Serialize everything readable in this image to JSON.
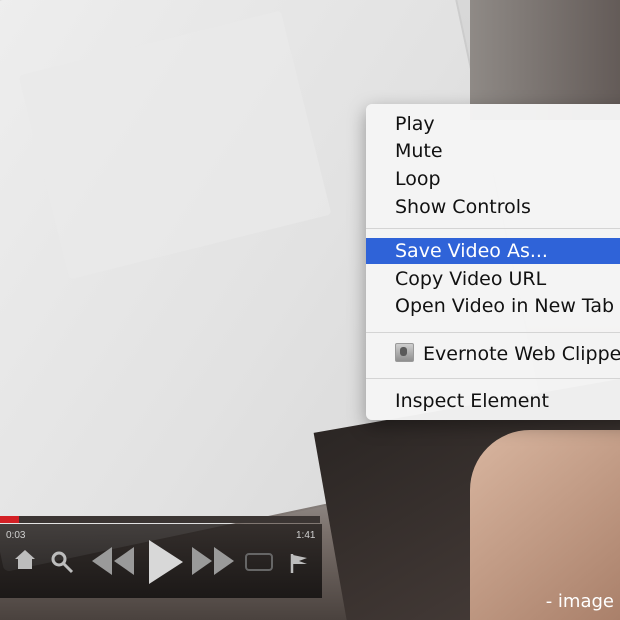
{
  "player": {
    "time_current": "0:03",
    "time_total": "1:41",
    "progress": 0.06,
    "accent": "#d32025"
  },
  "context_menu": {
    "items": [
      {
        "label": "Play"
      },
      {
        "label": "Mute"
      },
      {
        "label": "Loop"
      },
      {
        "label": "Show Controls"
      },
      {
        "label": "Save Video As..."
      },
      {
        "label": "Copy Video URL"
      },
      {
        "label": "Open Video in New Tab"
      },
      {
        "label": "Evernote Web Clipper"
      },
      {
        "label": "Inspect Element"
      }
    ],
    "selected_index": 4,
    "selected_color": "#2f63d8"
  },
  "caption": "- image"
}
